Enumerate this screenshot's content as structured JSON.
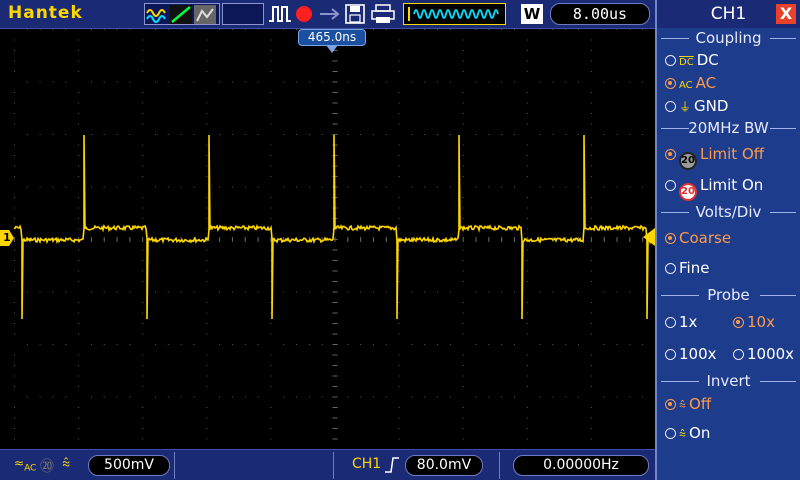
{
  "topbar": {
    "brand": "Hantek",
    "timebase": "8.00us",
    "w_badge": "W"
  },
  "screen": {
    "trigger_position": "465.0ns",
    "channel_marker": "1"
  },
  "bottombar": {
    "ch1_scale": "500mV",
    "trigger_channel": "CH1",
    "trigger_level": "80.0mV",
    "frequency": "0.00000Hz"
  },
  "panel": {
    "title": "CH1",
    "close_label": "X",
    "coupling": {
      "title": "Coupling",
      "options": [
        {
          "label": "DC",
          "icon": "DC",
          "selected": false
        },
        {
          "label": "AC",
          "icon": "AC",
          "selected": true
        },
        {
          "label": "GND",
          "icon": "",
          "selected": false
        }
      ]
    },
    "bandwidth": {
      "title": "20MHz BW",
      "options": [
        {
          "label": "Limit Off",
          "icon": "20",
          "selected": true
        },
        {
          "label": "Limit On",
          "icon": "20",
          "selected": false
        }
      ]
    },
    "volts_div": {
      "title": "Volts/Div",
      "options": [
        {
          "label": "Coarse",
          "selected": true
        },
        {
          "label": "Fine",
          "selected": false
        }
      ]
    },
    "probe": {
      "title": "Probe",
      "options": [
        {
          "label": "1x",
          "selected": false
        },
        {
          "label": "10x",
          "selected": true
        },
        {
          "label": "100x",
          "selected": false
        },
        {
          "label": "1000x",
          "selected": false
        }
      ]
    },
    "invert": {
      "title": "Invert",
      "options": [
        {
          "label": "Off",
          "selected": true
        },
        {
          "label": "On",
          "selected": false
        }
      ]
    }
  },
  "colors": {
    "trace": "#ffd700",
    "accent": "#ff9a4a",
    "panel_bg": "#1d3c8c",
    "bar_bg": "#1b2a74"
  }
}
